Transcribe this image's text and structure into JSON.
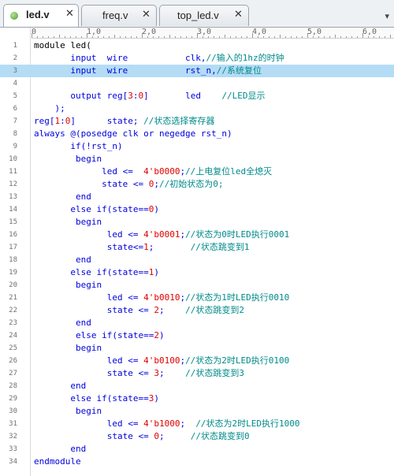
{
  "tabs": [
    {
      "label": "led.v",
      "close": "✕",
      "active": true
    },
    {
      "label": "freq.v",
      "close": "✕",
      "active": false
    },
    {
      "label": "top_led.v",
      "close": "✕",
      "active": false
    }
  ],
  "overflow_icon": "▾",
  "ruler_labels": [
    "0",
    "1,0",
    "2,0",
    "3,0",
    "4,0",
    "5,0",
    "6,0"
  ],
  "colors": {
    "keyword": "#0000dd",
    "number": "#e00000",
    "comment": "#008a8a",
    "highlight": "#b4dcf5"
  },
  "lines": [
    {
      "n": "1",
      "segs": [
        {
          "t": "module led(",
          "c": "pl"
        }
      ]
    },
    {
      "n": "2",
      "segs": [
        {
          "t": "       input  wire           clk,",
          "c": "kw"
        },
        {
          "t": "//输入的1hz的时钟",
          "c": "cm"
        }
      ]
    },
    {
      "n": "3",
      "hl": true,
      "segs": [
        {
          "t": "       input  wire           rst_n,",
          "c": "kw"
        },
        {
          "t": "//系统复位",
          "c": "cm"
        }
      ]
    },
    {
      "n": "4",
      "segs": []
    },
    {
      "n": "5",
      "segs": [
        {
          "t": "       output reg[",
          "c": "kw"
        },
        {
          "t": "3",
          "c": "num"
        },
        {
          "t": ":",
          "c": "kw"
        },
        {
          "t": "0",
          "c": "num"
        },
        {
          "t": "]       led    ",
          "c": "kw"
        },
        {
          "t": "//LED显示",
          "c": "cm"
        }
      ]
    },
    {
      "n": "6",
      "segs": [
        {
          "t": "    );",
          "c": "kw"
        }
      ]
    },
    {
      "n": "7",
      "segs": [
        {
          "t": "reg[",
          "c": "kw"
        },
        {
          "t": "1",
          "c": "num"
        },
        {
          "t": ":",
          "c": "kw"
        },
        {
          "t": "0",
          "c": "num"
        },
        {
          "t": "]      state; ",
          "c": "kw"
        },
        {
          "t": "//状态选择寄存器",
          "c": "cm"
        }
      ]
    },
    {
      "n": "8",
      "segs": [
        {
          "t": "always @(posedge clk or negedge rst_n)",
          "c": "kw"
        }
      ]
    },
    {
      "n": "9",
      "segs": [
        {
          "t": "       if(!rst_n)",
          "c": "kw"
        }
      ]
    },
    {
      "n": "10",
      "segs": [
        {
          "t": "        begin",
          "c": "kw"
        }
      ]
    },
    {
      "n": "11",
      "segs": [
        {
          "t": "             led <=  ",
          "c": "kw"
        },
        {
          "t": "4'b0000",
          "c": "num"
        },
        {
          "t": ";",
          "c": "kw"
        },
        {
          "t": "//上电复位led全熄灭",
          "c": "cm"
        }
      ]
    },
    {
      "n": "12",
      "segs": [
        {
          "t": "             state <= ",
          "c": "kw"
        },
        {
          "t": "0",
          "c": "num"
        },
        {
          "t": ";",
          "c": "kw"
        },
        {
          "t": "//初始状态为0;",
          "c": "cm"
        }
      ]
    },
    {
      "n": "13",
      "segs": [
        {
          "t": "        end",
          "c": "kw"
        }
      ]
    },
    {
      "n": "14",
      "segs": [
        {
          "t": "       else if(state==",
          "c": "kw"
        },
        {
          "t": "0",
          "c": "num"
        },
        {
          "t": ")",
          "c": "kw"
        }
      ]
    },
    {
      "n": "15",
      "segs": [
        {
          "t": "        begin",
          "c": "kw"
        }
      ]
    },
    {
      "n": "16",
      "segs": [
        {
          "t": "              led <= ",
          "c": "kw"
        },
        {
          "t": "4'b0001",
          "c": "num"
        },
        {
          "t": ";",
          "c": "kw"
        },
        {
          "t": "//状态为0时LED执行0001",
          "c": "cm"
        }
      ]
    },
    {
      "n": "17",
      "segs": [
        {
          "t": "              state<=",
          "c": "kw"
        },
        {
          "t": "1",
          "c": "num"
        },
        {
          "t": ";       ",
          "c": "kw"
        },
        {
          "t": "//状态跳变到1",
          "c": "cm"
        }
      ]
    },
    {
      "n": "18",
      "segs": [
        {
          "t": "        end",
          "c": "kw"
        }
      ]
    },
    {
      "n": "19",
      "segs": [
        {
          "t": "       else if(state==",
          "c": "kw"
        },
        {
          "t": "1",
          "c": "num"
        },
        {
          "t": ")",
          "c": "kw"
        }
      ]
    },
    {
      "n": "20",
      "segs": [
        {
          "t": "        begin",
          "c": "kw"
        }
      ]
    },
    {
      "n": "21",
      "segs": [
        {
          "t": "              led <= ",
          "c": "kw"
        },
        {
          "t": "4'b0010",
          "c": "num"
        },
        {
          "t": ";",
          "c": "kw"
        },
        {
          "t": "//状态为1时LED执行0010",
          "c": "cm"
        }
      ]
    },
    {
      "n": "22",
      "segs": [
        {
          "t": "              state <= ",
          "c": "kw"
        },
        {
          "t": "2",
          "c": "num"
        },
        {
          "t": ";    ",
          "c": "kw"
        },
        {
          "t": "//状态跳变到2",
          "c": "cm"
        }
      ]
    },
    {
      "n": "23",
      "segs": [
        {
          "t": "        end",
          "c": "kw"
        }
      ]
    },
    {
      "n": "24",
      "segs": [
        {
          "t": "        else if(state==",
          "c": "kw"
        },
        {
          "t": "2",
          "c": "num"
        },
        {
          "t": ")",
          "c": "kw"
        }
      ]
    },
    {
      "n": "25",
      "segs": [
        {
          "t": "        begin",
          "c": "kw"
        }
      ]
    },
    {
      "n": "26",
      "segs": [
        {
          "t": "              led <= ",
          "c": "kw"
        },
        {
          "t": "4'b0100",
          "c": "num"
        },
        {
          "t": ";",
          "c": "kw"
        },
        {
          "t": "//状态为2时LED执行0100",
          "c": "cm"
        }
      ]
    },
    {
      "n": "27",
      "segs": [
        {
          "t": "              state <= ",
          "c": "kw"
        },
        {
          "t": "3",
          "c": "num"
        },
        {
          "t": ";    ",
          "c": "kw"
        },
        {
          "t": "//状态跳变到3",
          "c": "cm"
        }
      ]
    },
    {
      "n": "28",
      "segs": [
        {
          "t": "       end",
          "c": "kw"
        }
      ]
    },
    {
      "n": "29",
      "segs": [
        {
          "t": "       else if(state==",
          "c": "kw"
        },
        {
          "t": "3",
          "c": "num"
        },
        {
          "t": ")",
          "c": "kw"
        }
      ]
    },
    {
      "n": "30",
      "segs": [
        {
          "t": "        begin",
          "c": "kw"
        }
      ]
    },
    {
      "n": "31",
      "segs": [
        {
          "t": "              led <= ",
          "c": "kw"
        },
        {
          "t": "4'b1000",
          "c": "num"
        },
        {
          "t": ";  ",
          "c": "kw"
        },
        {
          "t": "//状态为2时LED执行1000",
          "c": "cm"
        }
      ]
    },
    {
      "n": "32",
      "segs": [
        {
          "t": "              state <= ",
          "c": "kw"
        },
        {
          "t": "0",
          "c": "num"
        },
        {
          "t": ";     ",
          "c": "kw"
        },
        {
          "t": "//状态跳变到0",
          "c": "cm"
        }
      ]
    },
    {
      "n": "33",
      "segs": [
        {
          "t": "       end",
          "c": "kw"
        }
      ]
    },
    {
      "n": "34",
      "segs": [
        {
          "t": "endmodule",
          "c": "kw"
        }
      ]
    }
  ]
}
